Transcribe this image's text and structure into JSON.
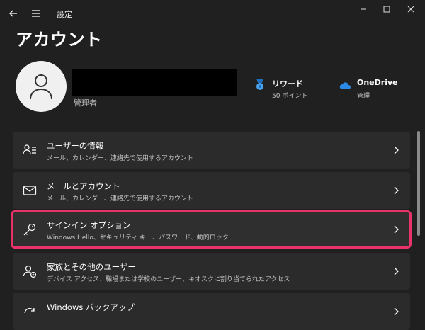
{
  "window": {
    "title": "設定",
    "controls": [
      "minimize",
      "maximize",
      "close"
    ]
  },
  "page": {
    "title": "アカウント"
  },
  "profile": {
    "role": "管理者"
  },
  "quick": {
    "rewards": {
      "title": "リワード",
      "sub": "50 ポイント",
      "icon": "rewards-medal-icon"
    },
    "onedrive": {
      "title": "OneDrive",
      "sub": "管理",
      "icon": "onedrive-cloud-icon"
    }
  },
  "cards": [
    {
      "title": "ユーザーの情報",
      "sub": "メール、カレンダー、連絡先で使用するアカウント",
      "icon": "user-info-icon"
    },
    {
      "title": "メールとアカウント",
      "sub": "メール、カレンダー、連絡先で使用するアカウント",
      "icon": "mail-icon"
    },
    {
      "title": "サインイン オプション",
      "sub": "Windows Hello、セキュリティ キー、パスワード、動的ロック",
      "icon": "key-icon"
    },
    {
      "title": "家族とその他のユーザー",
      "sub": "デバイス アクセス、職場または学校のユーザー、キオスクに割り当てられたアクセス",
      "icon": "family-icon"
    },
    {
      "title": "Windows バックアップ",
      "sub": "",
      "icon": "backup-icon"
    }
  ],
  "colors": {
    "background": "#202020",
    "card": "#2b2b2b",
    "highlight": "#e8336a",
    "accent": "#2a8ae6"
  }
}
